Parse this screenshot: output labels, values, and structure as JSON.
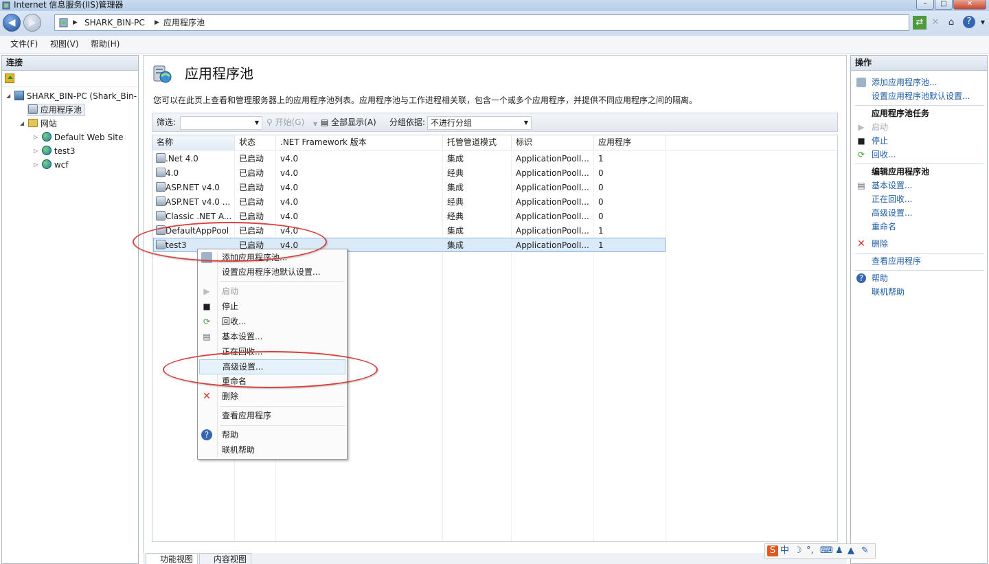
{
  "window": {
    "title": "Internet 信息服务(IIS)管理器"
  },
  "address": {
    "crumbs": [
      "SHARK_BIN-PC",
      "应用程序池"
    ]
  },
  "menu": [
    "文件(F)",
    "视图(V)",
    "帮助(H)"
  ],
  "connections": {
    "title": "连接",
    "tree": [
      {
        "label": "SHARK_BIN-PC (Shark_Bin-",
        "icon": "server-icon"
      },
      {
        "label": "应用程序池",
        "icon": "app-pool-icon",
        "selected": true
      },
      {
        "label": "网站",
        "icon": "folder-icon"
      },
      {
        "label": "Default Web Site",
        "icon": "globe-icon"
      },
      {
        "label": "test3",
        "icon": "globe-icon"
      },
      {
        "label": "wcf",
        "icon": "globe-icon"
      }
    ]
  },
  "main": {
    "title": "应用程序池",
    "description": "您可以在此页上查看和管理服务器上的应用程序池列表。应用程序池与工作进程相关联，包含一个或多个应用程序，并提供不同应用程序之间的隔离。",
    "filter": {
      "label": "筛选:",
      "start": "开始(G)",
      "show_all": "全部显示(A)",
      "group_label": "分组依据:",
      "group_value": "不进行分组"
    },
    "columns": [
      "名称",
      "状态",
      ".NET Framework 版本",
      "托管管道模式",
      "标识",
      "应用程序"
    ],
    "rows": [
      [
        ".Net 4.0",
        "已启动",
        "v4.0",
        "集成",
        "ApplicationPoolI...",
        "1"
      ],
      [
        "4.0",
        "已启动",
        "v4.0",
        "经典",
        "ApplicationPoolI...",
        "0"
      ],
      [
        "ASP.NET v4.0",
        "已启动",
        "v4.0",
        "集成",
        "ApplicationPoolI...",
        "0"
      ],
      [
        "ASP.NET v4.0 ...",
        "已启动",
        "v4.0",
        "经典",
        "ApplicationPoolI...",
        "0"
      ],
      [
        "Classic .NET A...",
        "已启动",
        "v4.0",
        "经典",
        "ApplicationPoolI...",
        "0"
      ],
      [
        "DefaultAppPool",
        "已启动",
        "v4.0",
        "集成",
        "ApplicationPoolI...",
        "1"
      ],
      [
        "test3",
        "已启动",
        "v4.0",
        "集成",
        "ApplicationPoolI...",
        "1"
      ]
    ],
    "bottom_tabs": [
      "功能视图",
      "内容视图"
    ]
  },
  "context_menu": {
    "add": "添加应用程序池...",
    "defaults": "设置应用程序池默认设置...",
    "start": "启动",
    "stop": "停止",
    "recycle": "回收...",
    "basic": "基本设置...",
    "recycling": "正在回收...",
    "advanced": "高级设置...",
    "rename": "重命名",
    "delete": "删除",
    "view_apps": "查看应用程序",
    "help": "帮助",
    "online_help": "联机帮助"
  },
  "actions": {
    "title": "操作",
    "add": "添加应用程序池...",
    "defaults": "设置应用程序池默认设置...",
    "tasks_head": "应用程序池任务",
    "start": "启动",
    "stop": "停止",
    "recycle": "回收...",
    "edit_head": "编辑应用程序池",
    "basic": "基本设置...",
    "recycling": "正在回收...",
    "advanced": "高级设置...",
    "rename": "重命名",
    "delete": "删除",
    "view_apps": "查看应用程序",
    "help": "帮助",
    "online_help": "联机帮助"
  },
  "ime": {
    "mode": "中"
  }
}
